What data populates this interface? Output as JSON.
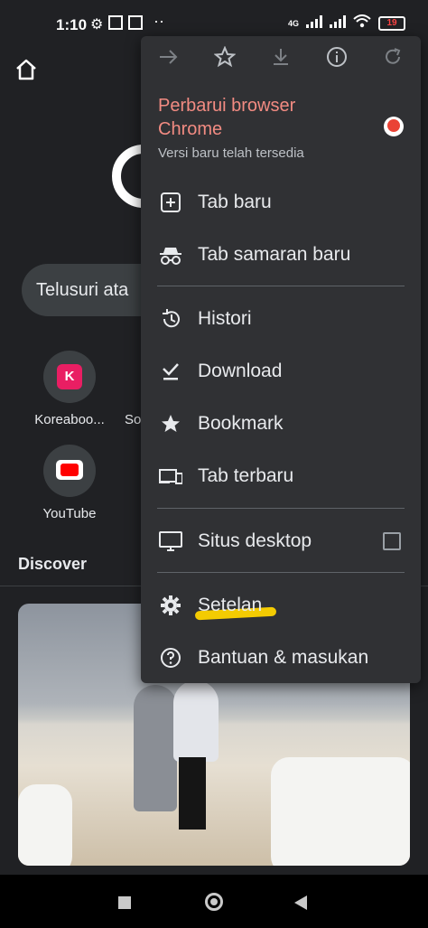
{
  "status_bar": {
    "time": "1:10",
    "network": "4G",
    "battery": "19"
  },
  "ntp": {
    "search_placeholder": "Telusuri ata",
    "shortcuts": [
      {
        "label": "Koreaboo...",
        "icon_letter": "K"
      },
      {
        "label": "So"
      },
      {
        "label": "YouTube"
      }
    ],
    "discover_label": "Discover"
  },
  "menu": {
    "update_title": "Perbarui browser Chrome",
    "update_subtitle": "Versi baru telah tersedia",
    "items": {
      "new_tab": "Tab baru",
      "incognito": "Tab samaran baru",
      "history": "Histori",
      "downloads": "Download",
      "bookmarks": "Bookmark",
      "recent_tabs": "Tab terbaru",
      "desktop_site": "Situs desktop",
      "settings": "Setelan",
      "help": "Bantuan & masukan"
    },
    "desktop_site_checked": false
  },
  "colors": {
    "menu_bg": "#303134",
    "update_title": "#f28b82",
    "highlight": "#ffd400"
  }
}
